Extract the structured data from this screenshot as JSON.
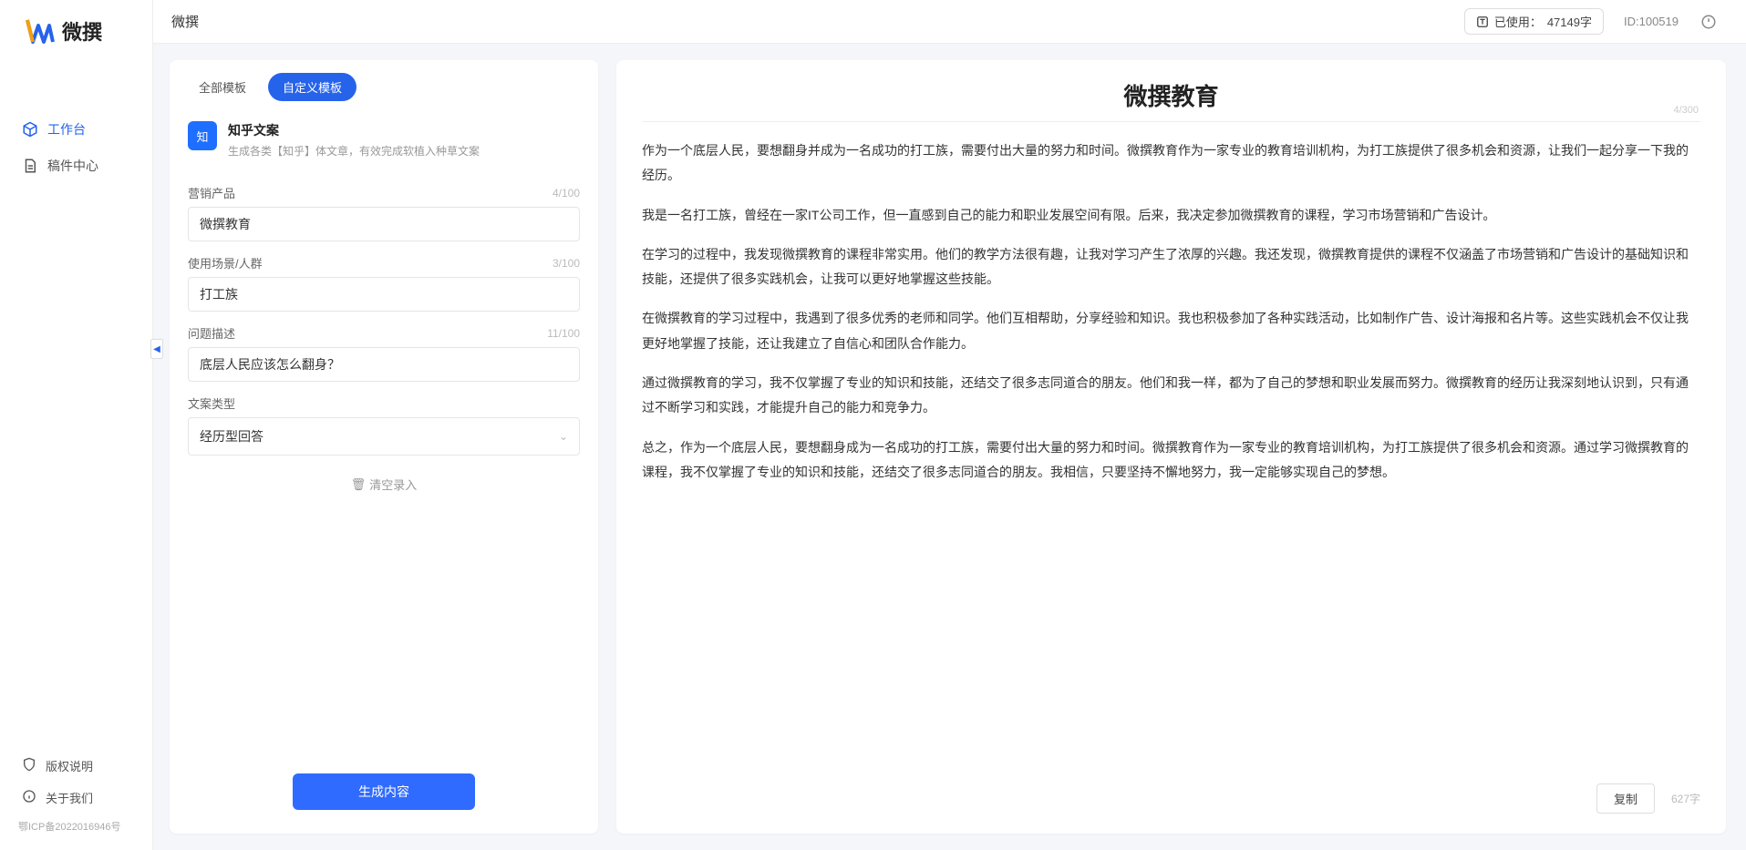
{
  "brand": {
    "name": "微撰"
  },
  "topbar": {
    "title": "微撰",
    "usage_label": "已使用：",
    "usage_value": "47149字",
    "id_label": "ID",
    "id_value": "100519"
  },
  "sidebar": {
    "items": [
      {
        "label": "工作台",
        "icon": "cube"
      },
      {
        "label": "稿件中心",
        "icon": "doc"
      }
    ],
    "bottom": [
      {
        "label": "版权说明",
        "icon": "shield"
      },
      {
        "label": "关于我们",
        "icon": "info"
      }
    ],
    "icp": "鄂ICP备2022016946号"
  },
  "tabs": {
    "all": "全部模板",
    "custom": "自定义模板"
  },
  "template": {
    "badge": "知",
    "title": "知乎文案",
    "desc": "生成各类【知乎】体文章，有效完成软植入种草文案"
  },
  "form": {
    "product": {
      "label": "营销产品",
      "value": "微撰教育",
      "count": "4/100"
    },
    "scene": {
      "label": "使用场景/人群",
      "value": "打工族",
      "count": "3/100"
    },
    "problem": {
      "label": "问题描述",
      "value": "底层人民应该怎么翻身？",
      "count": "11/100"
    },
    "type": {
      "label": "文案类型",
      "value": "经历型回答"
    },
    "clear": "清空录入",
    "submit": "生成内容"
  },
  "output": {
    "title": "微撰教育",
    "title_count": "4/300",
    "paragraphs": [
      "作为一个底层人民，要想翻身并成为一名成功的打工族，需要付出大量的努力和时间。微撰教育作为一家专业的教育培训机构，为打工族提供了很多机会和资源，让我们一起分享一下我的经历。",
      "我是一名打工族，曾经在一家IT公司工作，但一直感到自己的能力和职业发展空间有限。后来，我决定参加微撰教育的课程，学习市场营销和广告设计。",
      "在学习的过程中，我发现微撰教育的课程非常实用。他们的教学方法很有趣，让我对学习产生了浓厚的兴趣。我还发现，微撰教育提供的课程不仅涵盖了市场营销和广告设计的基础知识和技能，还提供了很多实践机会，让我可以更好地掌握这些技能。",
      "在微撰教育的学习过程中，我遇到了很多优秀的老师和同学。他们互相帮助，分享经验和知识。我也积极参加了各种实践活动，比如制作广告、设计海报和名片等。这些实践机会不仅让我更好地掌握了技能，还让我建立了自信心和团队合作能力。",
      "通过微撰教育的学习，我不仅掌握了专业的知识和技能，还结交了很多志同道合的朋友。他们和我一样，都为了自己的梦想和职业发展而努力。微撰教育的经历让我深刻地认识到，只有通过不断学习和实践，才能提升自己的能力和竞争力。",
      "总之，作为一个底层人民，要想翻身成为一名成功的打工族，需要付出大量的努力和时间。微撰教育作为一家专业的教育培训机构，为打工族提供了很多机会和资源。通过学习微撰教育的课程，我不仅掌握了专业的知识和技能，还结交了很多志同道合的朋友。我相信，只要坚持不懈地努力，我一定能够实现自己的梦想。"
    ],
    "copy": "复制",
    "char_count": "627字"
  }
}
